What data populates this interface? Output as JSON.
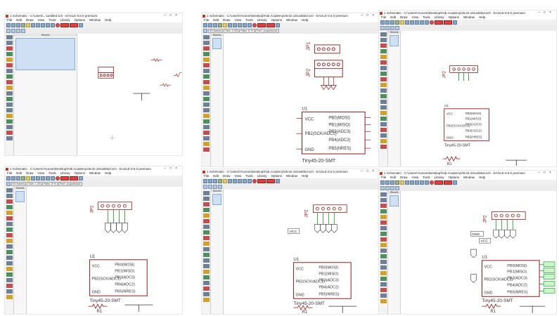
{
  "windows": [
    {
      "title": "1 Schematic - C:\\Users\\...\\untitled.sch - EAGLE 8.6.0 premium",
      "menu": [
        "File",
        "Edit",
        "Draw",
        "View",
        "Tools",
        "Library",
        "Options",
        "Window",
        "Help"
      ],
      "layer": "",
      "coordinate": "0.1 inch (0.6 0.8)",
      "sheets_label": "Sheets",
      "state": "empty-parts"
    },
    {
      "title": "1 Schematic - C:\\Users\\Yvonne\\Desktop\\Fab Academy\\26.02.15\\untitled.sch - EAGLE 8.6.0 premium",
      "menu": [
        "File",
        "Edit",
        "Draw",
        "View",
        "Tools",
        "Library",
        "Options",
        "Window",
        "Help"
      ],
      "layer": "93 Names",
      "size": "Size: 0.05",
      "ratio": "Ratio: 8 %",
      "font": "Font: proportional",
      "coordinate": "0.1 inch (0.4 0.8)",
      "sheets_label": "Sheets",
      "state": "two-headers"
    },
    {
      "title": "1 Schematic - C:\\Users\\Yvonne\\Desktop\\Fab Academy\\26.02.15\\untitled.sch - EAGLE 8.6.0 premium",
      "menu": [
        "File",
        "Edit",
        "Draw",
        "View",
        "Tools",
        "Library",
        "Options",
        "Window",
        "Help"
      ],
      "layer": "",
      "coordinate": "0.1 inch (0.4 0.8)",
      "sheets_label": "Sheets",
      "state": "one-header"
    },
    {
      "title": "1 Schematic - C:\\Users\\Yvonne\\Desktop\\Fab Academy\\26.02.15\\untitled.sch - EAGLE 8.6.0 premium",
      "menu": [
        "File",
        "Edit",
        "Draw",
        "View",
        "Tools",
        "Library",
        "Options",
        "Window",
        "Help"
      ],
      "layer": "93 Names",
      "size": "Size: 1.00",
      "ratio": "Ratio: 8 %",
      "font": "Font: proportional",
      "coordinate": "",
      "sheets_label": "Sheets",
      "state": "wired"
    },
    {
      "title": "1 Schematic - C:\\Users\\Yvonne\\Desktop\\Fab Academy\\26.02.15\\untitled.sch - EAGLE 8.6.0 premium",
      "menu": [
        "File",
        "Edit",
        "Draw",
        "View",
        "Tools",
        "Library",
        "Options",
        "Window",
        "Help"
      ],
      "layer": "",
      "coordinate": "0.1 inch (0.6 0.8)",
      "sheets_label": "Sheets",
      "state": "vcc-label"
    },
    {
      "title": "1 Schematic - C:\\Users\\Yvonne\\Desktop\\Fab Academy\\26.02.15\\untitled.sch - EAGLE 8.6.0 premium",
      "menu": [
        "File",
        "Edit",
        "Draw",
        "View",
        "Tools",
        "Library",
        "Options",
        "Window",
        "Help"
      ],
      "layer": "",
      "coordinate": "0.1 inch (0.6 0.8)",
      "sheets_label": "Sheets",
      "state": "all-labels"
    }
  ],
  "schematic": {
    "header_name": "JP2",
    "header_name_top": "JP1",
    "chip_name": "U1",
    "chip_value": "Tiny45-20-SMT",
    "left_pins": [
      "VCC",
      "PB2(SCK/ADC1)",
      "GND"
    ],
    "right_pins": [
      "PB0(MOSI)",
      "PB1(MISO)",
      "PB3(ADC3)",
      "PB4(ADC2)",
      "PB5(NRES)"
    ],
    "resistor_name": "R1",
    "vcc_label": "VCC",
    "gnd_label": "GND",
    "net_labels": [
      "MISO",
      "SCK",
      "MOSI",
      "RST",
      "GND",
      "VCC"
    ]
  },
  "colors": {
    "part": "#8b1a1a",
    "wire": "#1a8a2a",
    "pin": "#8b1a1a",
    "text": "#333333",
    "sheet_selected": "#cfe0f5"
  }
}
